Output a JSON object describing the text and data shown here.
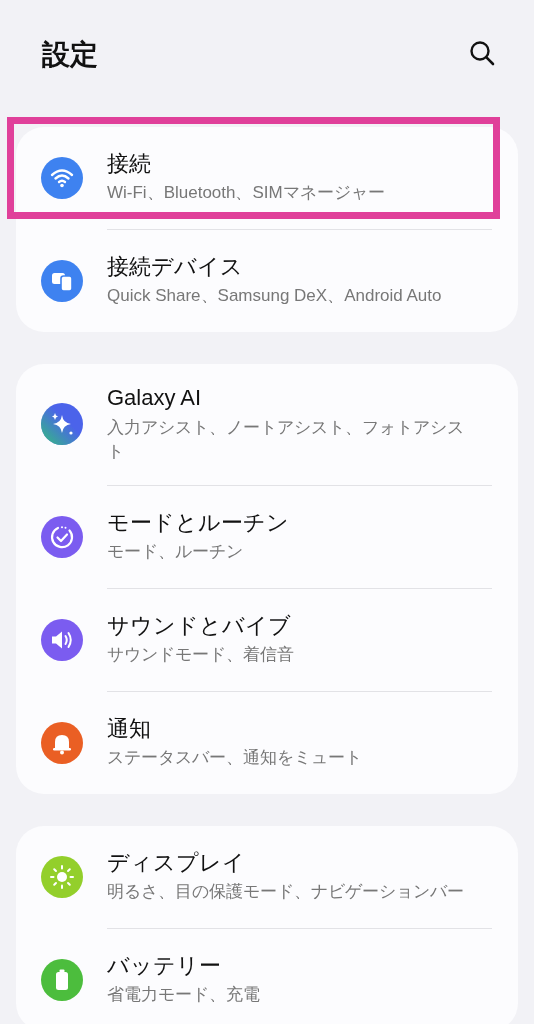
{
  "header": {
    "title": "設定"
  },
  "groups": [
    {
      "items": [
        {
          "kind": "wifi",
          "color": "#3e82f0",
          "title": "接続",
          "subtitle": "Wi-Fi、Bluetooth、SIMマネージャー",
          "highlighted": true
        },
        {
          "kind": "devices",
          "color": "#3e82f0",
          "title": "接続デバイス",
          "subtitle": "Quick Share、Samsung DeX、Android Auto",
          "highlighted": false
        }
      ]
    },
    {
      "items": [
        {
          "kind": "ai",
          "color": "#4b63ea",
          "title": "Galaxy AI",
          "subtitle": "入力アシスト、ノートアシスト、フォトアシスト",
          "highlighted": false
        },
        {
          "kind": "modes",
          "color": "#7b5cf0",
          "title": "モードとルーチン",
          "subtitle": "モード、ルーチン",
          "highlighted": false
        },
        {
          "kind": "sound",
          "color": "#7b5cf0",
          "title": "サウンドとバイブ",
          "subtitle": "サウンドモード、着信音",
          "highlighted": false
        },
        {
          "kind": "bell",
          "color": "#ea5f24",
          "title": "通知",
          "subtitle": "ステータスバー、通知をミュート",
          "highlighted": false
        }
      ]
    },
    {
      "items": [
        {
          "kind": "display",
          "color": "#93cf2b",
          "title": "ディスプレイ",
          "subtitle": "明るさ、目の保護モード、ナビゲーションバー",
          "highlighted": false
        },
        {
          "kind": "battery",
          "color": "#4cbd3d",
          "title": "バッテリー",
          "subtitle": "省電力モード、充電",
          "highlighted": false
        }
      ]
    }
  ]
}
